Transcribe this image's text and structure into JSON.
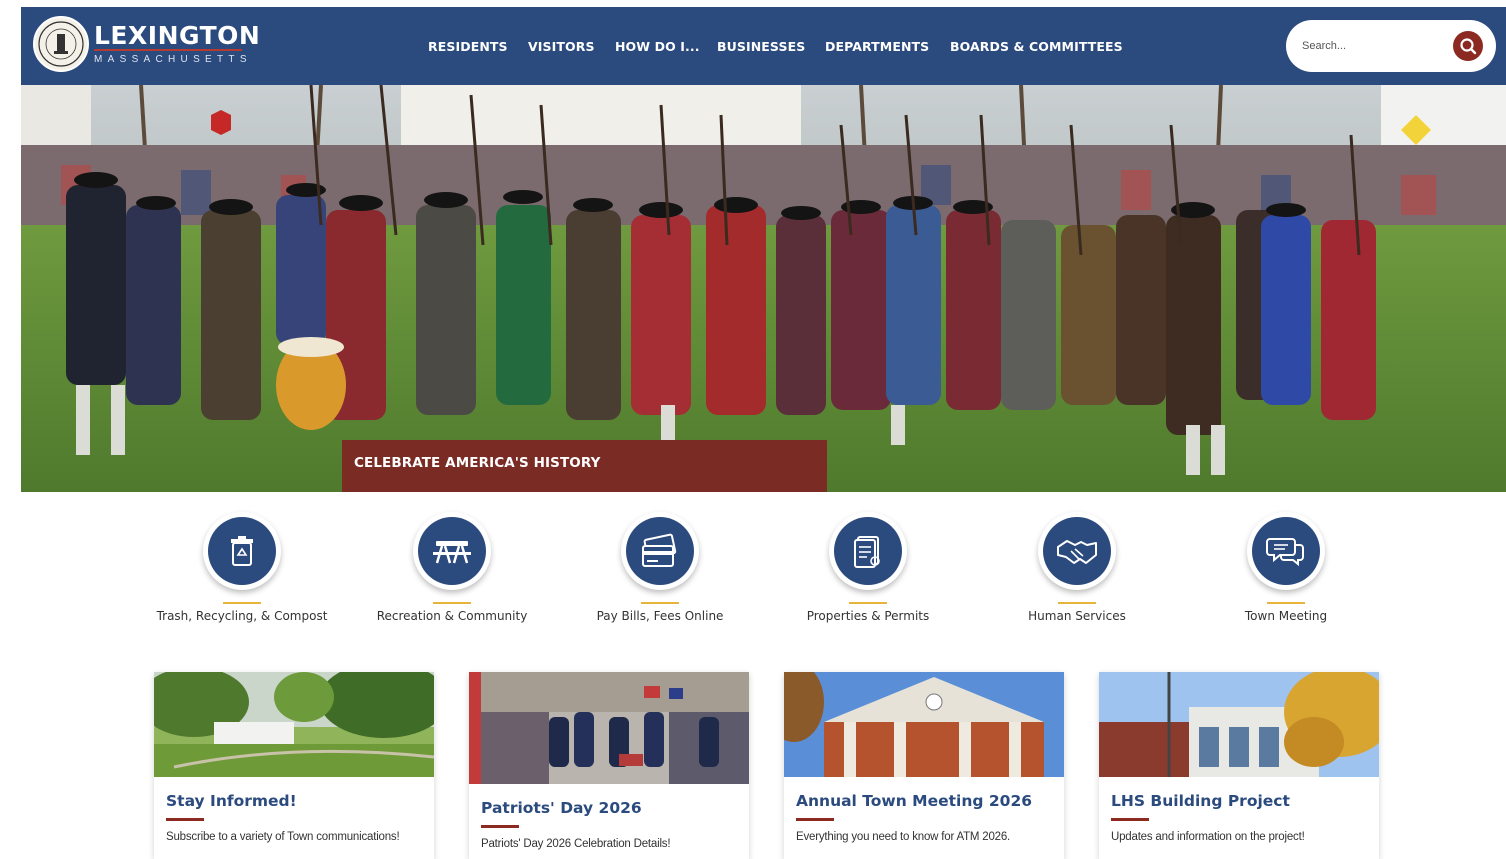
{
  "header": {
    "logo_title": "LEXINGTON",
    "logo_subtitle": "MASSACHUSETTS",
    "nav": [
      {
        "label": "RESIDENTS"
      },
      {
        "label": "VISITORS"
      },
      {
        "label": "HOW DO I..."
      },
      {
        "label": "BUSINESSES"
      },
      {
        "label": "DEPARTMENTS"
      },
      {
        "label": "BOARDS & COMMITTEES"
      }
    ],
    "search": {
      "placeholder": "Search...",
      "icon": "search-icon"
    }
  },
  "hero": {
    "caption": "CELEBRATE AMERICA'S HISTORY"
  },
  "quick_links": [
    {
      "label": "Trash, Recycling, & Compost",
      "icon": "recycle-bin-icon"
    },
    {
      "label": "Recreation & Community",
      "icon": "picnic-table-icon"
    },
    {
      "label": "Pay Bills, Fees Online",
      "icon": "credit-card-icon"
    },
    {
      "label": "Properties & Permits",
      "icon": "document-icon"
    },
    {
      "label": "Human Services",
      "icon": "handshake-icon"
    },
    {
      "label": "Town Meeting",
      "icon": "chat-bubbles-icon"
    }
  ],
  "cards": [
    {
      "title": "Stay Informed!",
      "description": "Subscribe to a variety of Town communications!"
    },
    {
      "title": "Patriots' Day 2026",
      "description": "Patriots' Day 2026 Celebration Details!"
    },
    {
      "title": "Annual Town Meeting 2026",
      "description": "Everything you need to know for ATM 2026."
    },
    {
      "title": "LHS Building Project",
      "description": "Updates and information on the project!"
    }
  ],
  "colors": {
    "navy": "#2b4a7e",
    "maroon": "#8c2a22",
    "gold": "#e7b43a"
  }
}
